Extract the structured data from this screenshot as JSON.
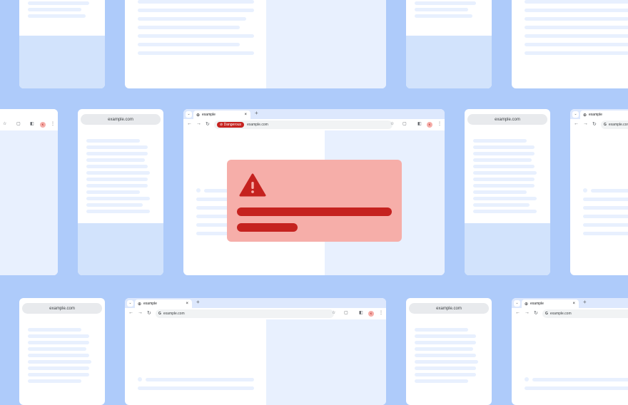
{
  "site": {
    "url": "example.com",
    "tab_title": "example"
  },
  "main_browser": {
    "tab_title": "example",
    "new_tab_symbol": "+",
    "close_symbol": "×",
    "danger_chip_label": "Dangerous",
    "url": "example.com",
    "avatar_letter": "K"
  },
  "warning_card": {
    "icon": "warning-triangle-icon",
    "color_bg": "#f6aea9",
    "color_accent": "#c5221f"
  },
  "colors": {
    "background": "#aecbfa",
    "skeleton": "#e8f0fe",
    "pane": "#d2e3fc"
  }
}
